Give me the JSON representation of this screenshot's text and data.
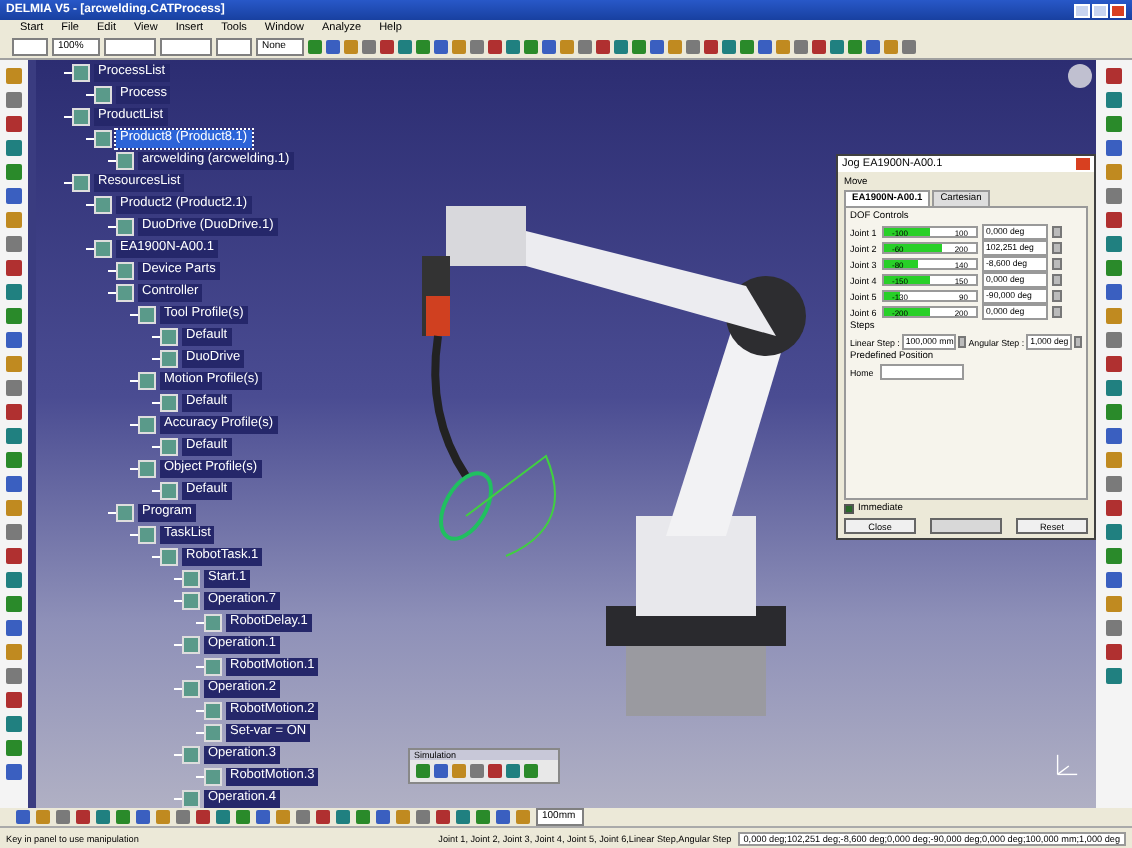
{
  "window": {
    "title": "DELMIA V5 - [arcwelding.CATProcess]"
  },
  "menu": [
    "Start",
    "File",
    "Edit",
    "View",
    "Insert",
    "Tools",
    "Window",
    "Analyze",
    "Help"
  ],
  "toolbar": {
    "zoom": "100%",
    "line_type": "None"
  },
  "tree": [
    {
      "label": "ProcessList",
      "selected": false,
      "children": [
        {
          "label": "Process",
          "selected": false
        }
      ]
    },
    {
      "label": "ProductList",
      "selected": false,
      "children": [
        {
          "label": "Product8 (Product8.1)",
          "selected": true,
          "children": [
            {
              "label": "arcwelding (arcwelding.1)",
              "selected": false
            }
          ]
        }
      ]
    },
    {
      "label": "ResourcesList",
      "selected": false,
      "children": [
        {
          "label": "Product2 (Product2.1)",
          "selected": false,
          "children": [
            {
              "label": "DuoDrive (DuoDrive.1)",
              "selected": false
            }
          ]
        },
        {
          "label": "EA1900N-A00.1",
          "selected": false,
          "children": [
            {
              "label": "Device Parts",
              "selected": false
            },
            {
              "label": "Controller",
              "selected": false,
              "children": [
                {
                  "label": "Tool Profile(s)",
                  "selected": false,
                  "children": [
                    {
                      "label": "Default",
                      "selected": false
                    },
                    {
                      "label": "DuoDrive",
                      "selected": false
                    }
                  ]
                },
                {
                  "label": "Motion Profile(s)",
                  "selected": false,
                  "children": [
                    {
                      "label": "Default",
                      "selected": false
                    }
                  ]
                },
                {
                  "label": "Accuracy Profile(s)",
                  "selected": false,
                  "children": [
                    {
                      "label": "Default",
                      "selected": false
                    }
                  ]
                },
                {
                  "label": "Object Profile(s)",
                  "selected": false,
                  "children": [
                    {
                      "label": "Default",
                      "selected": false
                    }
                  ]
                }
              ]
            },
            {
              "label": "Program",
              "selected": false,
              "children": [
                {
                  "label": "TaskList",
                  "selected": false,
                  "children": [
                    {
                      "label": "RobotTask.1",
                      "selected": false,
                      "children": [
                        {
                          "label": "Start.1",
                          "selected": false
                        },
                        {
                          "label": "Operation.7",
                          "selected": false,
                          "children": [
                            {
                              "label": "RobotDelay.1",
                              "selected": false
                            }
                          ]
                        },
                        {
                          "label": "Operation.1",
                          "selected": false,
                          "children": [
                            {
                              "label": "RobotMotion.1",
                              "selected": false
                            }
                          ]
                        },
                        {
                          "label": "Operation.2",
                          "selected": false,
                          "children": [
                            {
                              "label": "RobotMotion.2",
                              "selected": false
                            },
                            {
                              "label": "Set-var = ON",
                              "selected": false
                            }
                          ]
                        },
                        {
                          "label": "Operation.3",
                          "selected": false,
                          "children": [
                            {
                              "label": "RobotMotion.3",
                              "selected": false
                            }
                          ]
                        },
                        {
                          "label": "Operation.4",
                          "selected": false
                        }
                      ]
                    }
                  ]
                }
              ]
            }
          ]
        }
      ]
    }
  ],
  "jog_dialog": {
    "title": "Jog EA1900N-A00.1",
    "group": "Move",
    "tabs": [
      {
        "label": "EA1900N-A00.1",
        "selected": true
      },
      {
        "label": "Cartesian",
        "selected": false
      }
    ],
    "dof_title": "DOF Controls",
    "joints": [
      {
        "name": "Joint 1",
        "min": "-100",
        "max": "100",
        "level": 0.5,
        "value": "0,000 deg"
      },
      {
        "name": "Joint 2",
        "min": "-60",
        "max": "200",
        "level": 0.62,
        "value": "102,251 deg"
      },
      {
        "name": "Joint 3",
        "min": "-80",
        "max": "140",
        "level": 0.38,
        "value": "-8,600 deg"
      },
      {
        "name": "Joint 4",
        "min": "-150",
        "max": "150",
        "level": 0.5,
        "value": "0,000 deg"
      },
      {
        "name": "Joint 5",
        "min": "-130",
        "max": "90",
        "level": 0.18,
        "value": "-90,000 deg"
      },
      {
        "name": "Joint 6",
        "min": "-200",
        "max": "200",
        "level": 0.5,
        "value": "0,000 deg"
      }
    ],
    "steps_title": "Steps",
    "linear_label": "Linear Step :",
    "linear_value": "100,000 mm",
    "angular_label": "Angular Step :",
    "angular_value": "1,000 deg",
    "predefined_title": "Predefined Position",
    "home_label": "Home",
    "immediate": {
      "label": "Immediate",
      "checked": true
    },
    "buttons": [
      {
        "label": "Close",
        "disabled": false
      },
      {
        "disabled": true
      },
      {
        "label": "Reset",
        "disabled": false
      }
    ]
  },
  "simulation_toolbar": {
    "title": "Simulation"
  },
  "bottom_toolbar": {
    "step": "100mm"
  },
  "status_bar": {
    "prompt": "Key in panel to use manipulation",
    "fields": "Joint 1, Joint 2, Joint 3, Joint 4, Joint 5, Joint 6,Linear Step,Angular Step",
    "value": "0,000 deg;102,251 deg;-8,600 deg;0,000 deg;-90,000 deg;0,000 deg;100,000 mm;1,000 deg"
  }
}
